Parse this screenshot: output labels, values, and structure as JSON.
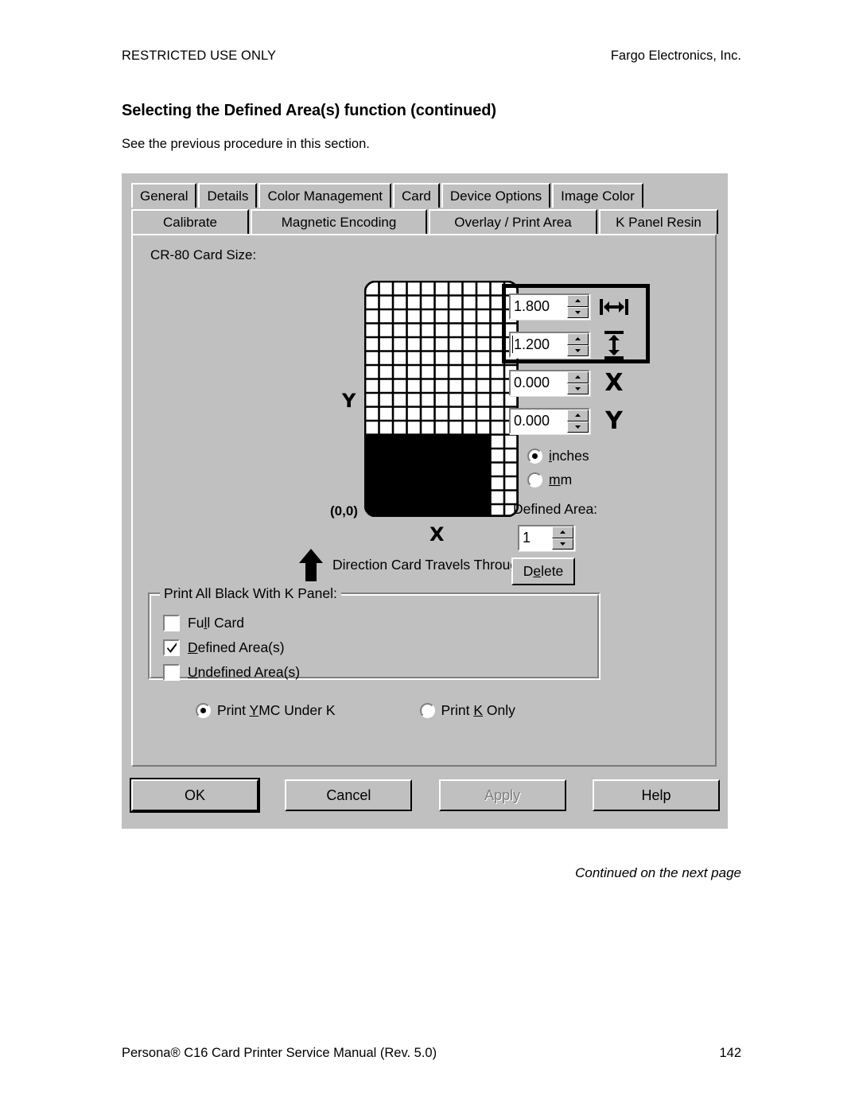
{
  "document": {
    "header_left": "RESTRICTED USE ONLY",
    "header_right": "Fargo Electronics, Inc.",
    "title": "Selecting the Defined Area(s) function (continued)",
    "subtitle": "See the previous procedure in this section.",
    "continued_note": "Continued on the next page",
    "footer_left": "Persona® C16 Card Printer Service Manual (Rev. 5.0)",
    "footer_page": "142"
  },
  "dialog": {
    "tabs_row1": [
      {
        "label": "General",
        "selected": false
      },
      {
        "label": "Details",
        "selected": false
      },
      {
        "label": "Color Management",
        "selected": false
      },
      {
        "label": "Card",
        "selected": false
      },
      {
        "label": "Device Options",
        "selected": false
      },
      {
        "label": "Image Color",
        "selected": false
      }
    ],
    "tabs_row2": [
      {
        "label": "Calibrate",
        "selected": false
      },
      {
        "label": "Magnetic Encoding",
        "selected": false
      },
      {
        "label": "Overlay / Print Area",
        "selected": false
      },
      {
        "label": "K Panel Resin",
        "selected": true
      }
    ],
    "card_size_label": "CR-80 Card Size:",
    "card_graphic": {
      "y_axis_label": "Y",
      "x_axis_label": "X",
      "origin_label": "(0,0)",
      "direction_text": "Direction Card Travels Through Printer",
      "grid_columns": 11,
      "grid_rows": 17,
      "selection_fill_color": "#000000",
      "selection_cols": 9,
      "selection_rows": 6
    },
    "spinners": [
      {
        "name": "width",
        "value": "1.800",
        "icon": "width-icon",
        "highlighted": true,
        "caret": false
      },
      {
        "name": "height",
        "value": "1.200",
        "icon": "height-icon",
        "highlighted": true,
        "caret": true
      },
      {
        "name": "x-offset",
        "value": "0.000",
        "icon": "X",
        "highlighted": false,
        "caret": false
      },
      {
        "name": "y-offset",
        "value": "0.000",
        "icon": "Y",
        "highlighted": false,
        "caret": false
      }
    ],
    "units": [
      {
        "label": "inches",
        "accel": "i",
        "selected": true
      },
      {
        "label": "mm",
        "accel": "m",
        "selected": false
      }
    ],
    "defined_area": {
      "label": "Defined Area:",
      "value": "1",
      "delete_label": "Delete",
      "delete_accel": "e"
    },
    "print_all_black_group": {
      "title": "Print All Black With K Panel:",
      "options": [
        {
          "label": "Full Card",
          "checked": false
        },
        {
          "label": "Defined Area(s)",
          "checked": true
        },
        {
          "label": "Undefined Area(s)",
          "checked": false
        }
      ]
    },
    "print_mode": [
      {
        "label": "Print YMC Under K",
        "selected": true
      },
      {
        "label": "Print K Only",
        "selected": false
      }
    ],
    "buttons": [
      {
        "label": "OK",
        "default": true,
        "disabled": false
      },
      {
        "label": "Cancel",
        "default": false,
        "disabled": false
      },
      {
        "label": "Apply",
        "default": false,
        "disabled": true
      },
      {
        "label": "Help",
        "default": false,
        "disabled": false
      }
    ]
  },
  "colors": {
    "dialog_face": "#c0c0c0",
    "page_background": "#ffffff",
    "text": "#000000",
    "disabled_text": "#808080"
  }
}
